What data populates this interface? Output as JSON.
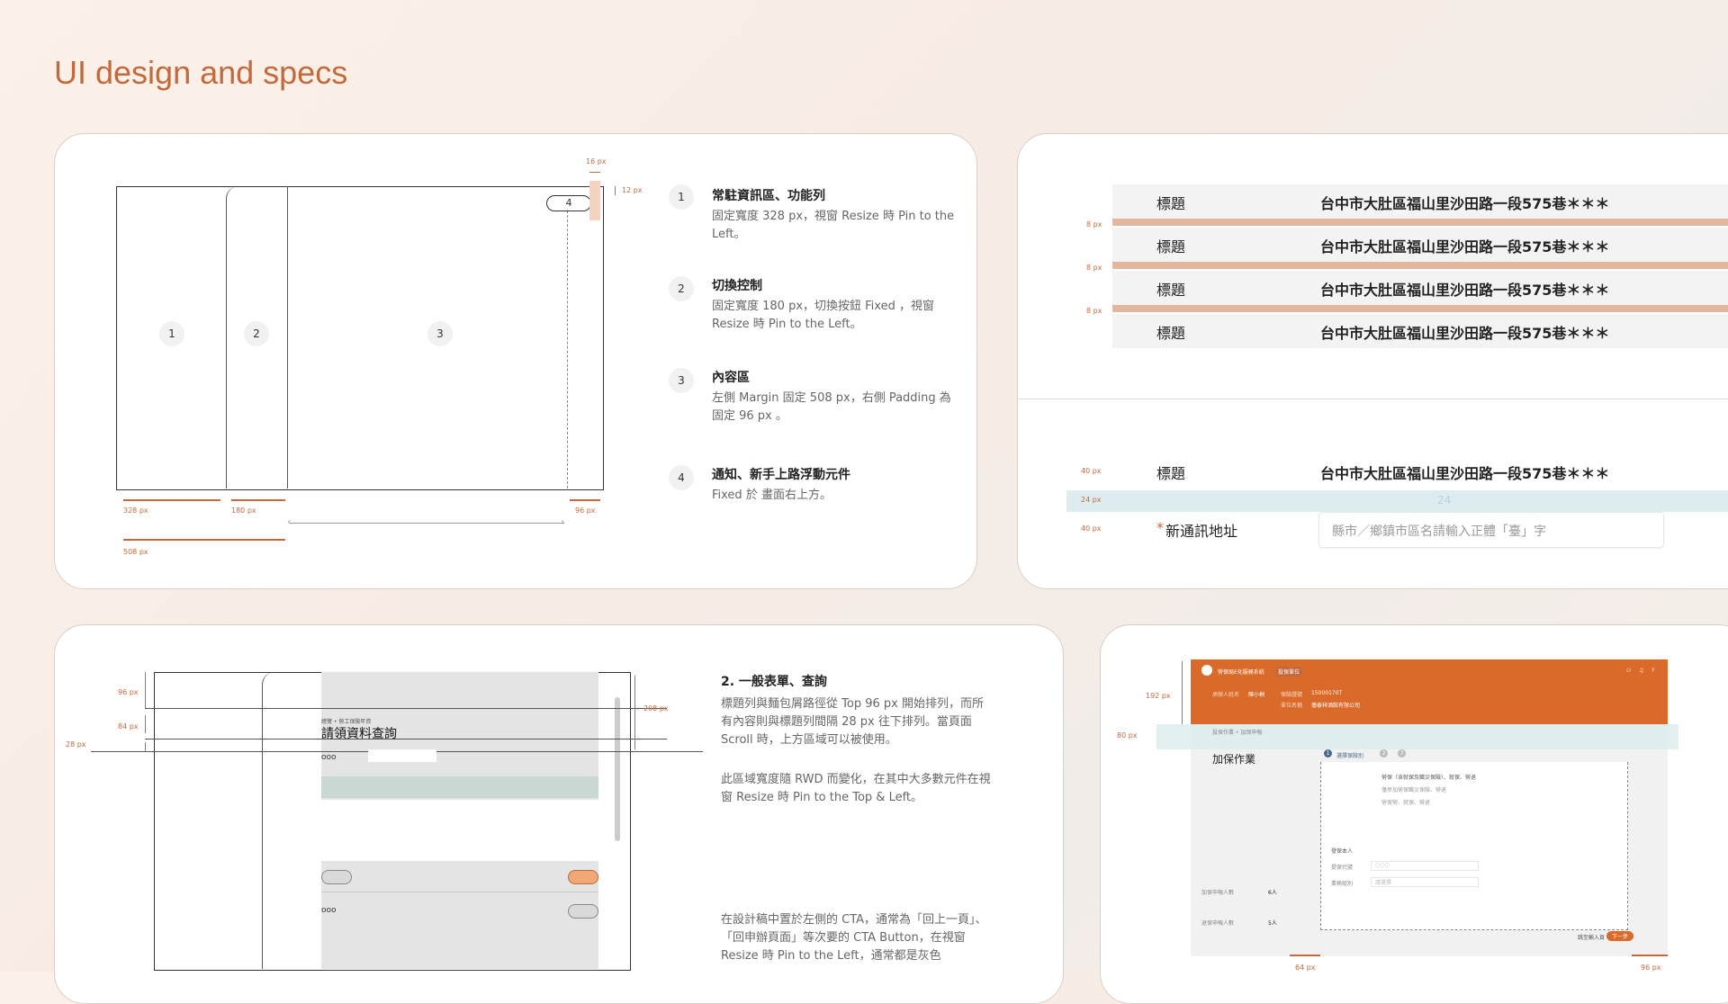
{
  "page": {
    "title": "UI design and specs"
  },
  "layout_card": {
    "zones": [
      "1",
      "2",
      "3"
    ],
    "float_badge": "4",
    "dims": {
      "top": "16 px",
      "side": "12 px",
      "w1": "328 px",
      "w2": "180 px",
      "w3": "96 px",
      "margin": "508 px"
    },
    "steps": [
      {
        "num": "1",
        "title": "常駐資訊區、功能列",
        "desc": "固定寬度 328 px，視窗 Resize 時 Pin to the Left。"
      },
      {
        "num": "2",
        "title": "切換控制",
        "desc": "固定寬度 180 px，切換按鈕 Fixed ，視窗 Resize 時 Pin to the Left。"
      },
      {
        "num": "3",
        "title": "內容區",
        "desc": "左側 Margin 固定 508 px，右側 Padding 為固定 96 px 。"
      },
      {
        "num": "4",
        "title": "通知、新手上路浮動元件",
        "desc": "Fixed 於 畫面右上方。"
      }
    ]
  },
  "rows_card": {
    "rows": [
      {
        "label": "標題",
        "value": "台中市大肚區福山里沙田路一段575巷＊＊＊"
      },
      {
        "label": "標題",
        "value": "台中市大肚區福山里沙田路一段575巷＊＊＊"
      },
      {
        "label": "標題",
        "value": "台中市大肚區福山里沙田路一段575巷＊＊＊"
      },
      {
        "label": "標題",
        "value": "台中市大肚區福山里沙田路一段575巷＊＊＊"
      }
    ],
    "gap_label": "8 px",
    "form": {
      "row_label": "標題",
      "row_value": "台中市大肚區福山里沙田路一段575巷＊＊＊",
      "h_top": "40 px",
      "h_gap": "24 px",
      "gap_marker": "24",
      "h_bottom": "40 px",
      "required_mark": "*",
      "field_label": "新通訊地址",
      "field_placeholder": "縣市／鄉鎮市區名請輸入正體「臺」字"
    }
  },
  "form_card": {
    "dims": {
      "top": "96 px",
      "title_h": "84 px",
      "gap": "28 px",
      "side": "208 px"
    },
    "breadcrumb": "總覽 • 勞工保險年資",
    "title": "請領資料查詢",
    "ooo1": "ooo",
    "ooo2": "ooo",
    "heading": "2. 一般表單、查詢",
    "para1": "標題列與麵包屑路徑從 Top 96 px 開始排列，而所有內容則與標題列間隔 28 px 往下排列。當頁面 Scroll 時，上方區域可以被使用。",
    "para2": "此區域寬度隨 RWD 而變化，在其中大多數元件在視窗 Resize 時 Pin to the Top & Left。",
    "para3": "在設計稿中置於左側的 CTA，通常為「回上一頁」、「回申辦頁面」等次要的 CTA Button，在視窗 Resize 時 Pin to the Left，通常都是灰色"
  },
  "screen_card": {
    "dims": {
      "header": "192 px",
      "title_h": "80 px",
      "left": "64 px",
      "right": "96 px"
    },
    "app_title": "勞保局E化服務系統",
    "badge": "投保單位",
    "header_fields": [
      {
        "label": "承辦人姓名",
        "value": "陳小桐"
      },
      {
        "label": "保險證號",
        "value": "15000170T"
      },
      {
        "label": "單位名稱",
        "value": "億泰祥酒館有限公司"
      }
    ],
    "breadcrumb": "投保作業 • 加保申報",
    "page_title": "加保作業",
    "stepper": [
      "1",
      "2",
      "3"
    ],
    "stepper_label": "選擇保險別",
    "options": [
      "勞保（含就保及職災保險）、就保、勞退",
      "僅參加勞保職災保險、勞退",
      "勞保勞、就保、勞退"
    ],
    "checkbox_label": "發保本人",
    "field1": "提保代號",
    "field2": "業務組別",
    "field1_ph": "○○○",
    "field2_ph": "請選擇",
    "side_items": [
      {
        "text": "加保申報人數",
        "count": "6人"
      },
      {
        "text": "退保申報人數",
        "count": "5人"
      }
    ],
    "cta_secondary": "跳至輸入頁",
    "cta_primary": "下一步"
  },
  "colors": {
    "accent": "#c26a3d",
    "orange_header": "#d96a2a",
    "bar": "#e3b6a0",
    "teal": "#cfe2e2"
  }
}
